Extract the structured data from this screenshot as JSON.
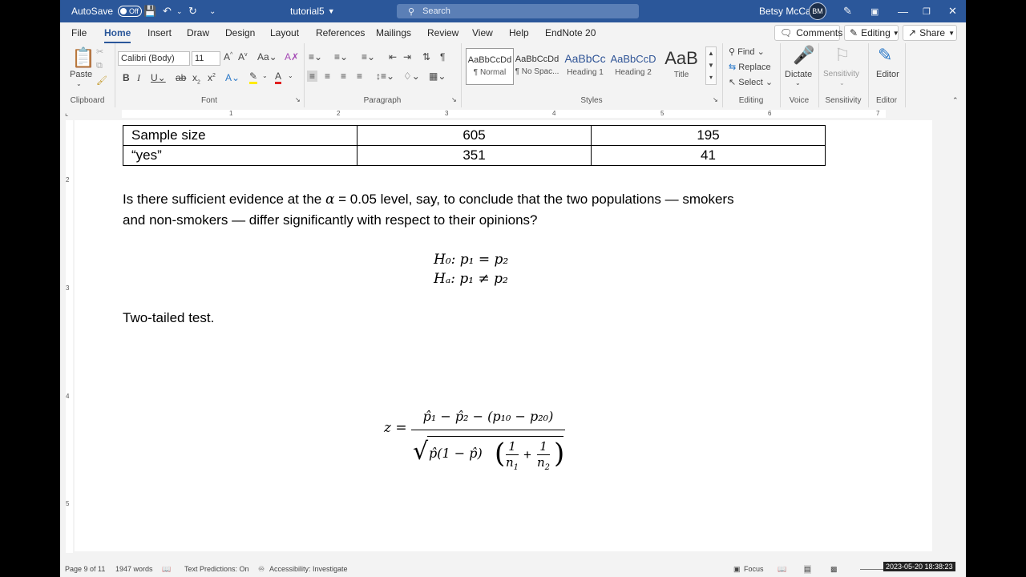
{
  "titlebar": {
    "autosave_label": "AutoSave",
    "autosave_state": "Off",
    "document_name": "tutorial5",
    "search_placeholder": "Search",
    "user_name": "Betsy McCall",
    "accent_color": "#2b579a"
  },
  "menu": {
    "tabs": [
      "File",
      "Home",
      "Insert",
      "Draw",
      "Design",
      "Layout",
      "References",
      "Mailings",
      "Review",
      "View",
      "Help",
      "EndNote 20"
    ],
    "active_tab": "Home",
    "comments_label": "Comments",
    "editing_label": "Editing",
    "share_label": "Share"
  },
  "ribbon": {
    "clipboard": {
      "paste_label": "Paste",
      "group_label": "Clipboard"
    },
    "font": {
      "font_name": "Calibri (Body)",
      "font_size": "11",
      "group_label": "Font"
    },
    "paragraph": {
      "group_label": "Paragraph"
    },
    "styles": {
      "items": [
        {
          "sample": "AaBbCcDd",
          "name": "¶ Normal"
        },
        {
          "sample": "AaBbCcDd",
          "name": "¶ No Spac..."
        },
        {
          "sample": "AaBbCc",
          "name": "Heading 1"
        },
        {
          "sample": "AaBbCcD",
          "name": "Heading 2"
        },
        {
          "sample": "AaB",
          "name": "Title"
        }
      ],
      "group_label": "Styles"
    },
    "editing": {
      "find": "Find",
      "replace": "Replace",
      "select": "Select",
      "group_label": "Editing"
    },
    "voice": {
      "dictate": "Dictate",
      "group_label": "Voice"
    },
    "sensitivity": {
      "label": "Sensitivity",
      "group_label": "Sensitivity"
    },
    "editor": {
      "label": "Editor",
      "group_label": "Editor"
    }
  },
  "ruler": {
    "numbers": [
      "1",
      "2",
      "3",
      "4",
      "5",
      "6",
      "7"
    ],
    "vertical_numbers": [
      "2",
      "3",
      "4",
      "5"
    ]
  },
  "document": {
    "table": [
      [
        "Sample size",
        "605",
        "195"
      ],
      [
        "“yes”",
        "351",
        "41"
      ]
    ],
    "question_line1_a": "Is there sufficient evidence at the ",
    "question_alpha": "α",
    "question_line1_b": " = 0.05 level, say, to conclude that the two populations — smokers",
    "question_line2": "and non-smokers — differ significantly with respect to their opinions?",
    "h0": "H₀: p₁ = p₂",
    "ha": "Hₐ: p₁ ≠ p₂",
    "test_type": "Two-tailed test.",
    "z_label": "z =",
    "z_numerator": "p̂₁ − p̂₂ − (p₁₀ − p₂₀)",
    "z_denominator": "p̂(1 − p̂)"
  },
  "status": {
    "page": "Page 9 of 11",
    "words": "1947 words",
    "text_predictions": "Text Predictions: On",
    "accessibility": "Accessibility: Investigate",
    "focus": "Focus",
    "timestamp": "2023-05-20 18:38:23"
  }
}
